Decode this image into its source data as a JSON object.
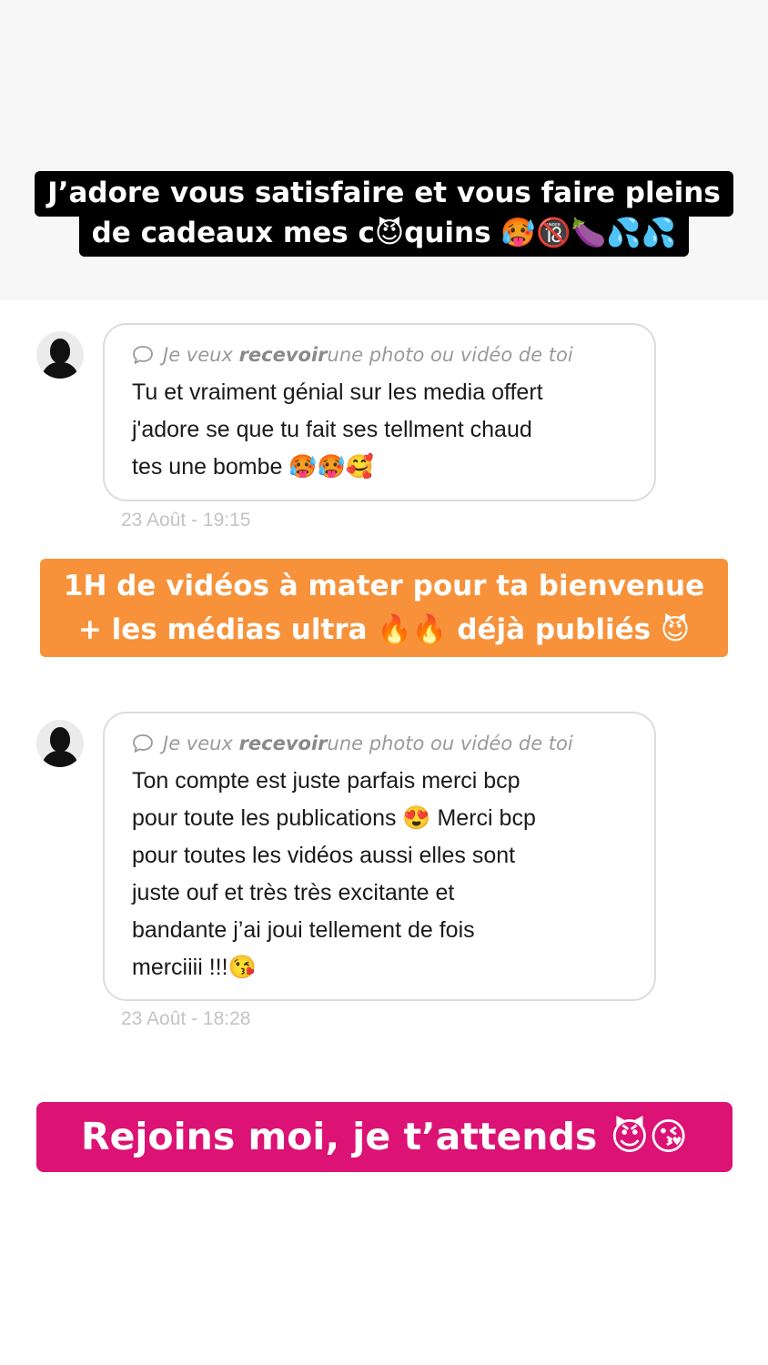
{
  "header_caption": {
    "line1": "J’adore vous satisfaire et vous faire pleins",
    "line2": "de cadeaux mes c😈quins 🥵🔞🍆💦💦"
  },
  "messages": [
    {
      "prompt_prefix": "Je veux ",
      "prompt_bold": "recevoir",
      "prompt_suffix": " une photo ou vidéo de toi",
      "lines": [
        "Tu et vraiment génial sur les media offert",
        "j'adore se que tu fait ses tellment chaud",
        "tes une bombe 🥵🥵🥰"
      ],
      "date": "23 Août - 19:15"
    },
    {
      "prompt_prefix": "Je veux ",
      "prompt_bold": "recevoir",
      "prompt_suffix": " une photo ou vidéo de toi",
      "lines": [
        "Ton compte est juste parfais merci bcp",
        "pour toute les publications 😍 Merci bcp",
        "pour toutes les vidéos aussi elles sont",
        "juste ouf et très très excitante et",
        "bandante j’ai joui tellement de fois",
        "merciiii !!!😘"
      ],
      "date": "23 Août - 18:28"
    }
  ],
  "promo": {
    "line1": "1H de vidéos à mater pour ta bienvenue",
    "line2": "+ les médias ultra 🔥🔥 déjà publiés 😈"
  },
  "cta": "Rejoins moi, je t’attends 😈😘",
  "colors": {
    "orange": "#f7923a",
    "pink": "#dc1274",
    "black": "#000000"
  },
  "icons": [
    "avatar-silhouette",
    "speech-bubble-icon"
  ]
}
